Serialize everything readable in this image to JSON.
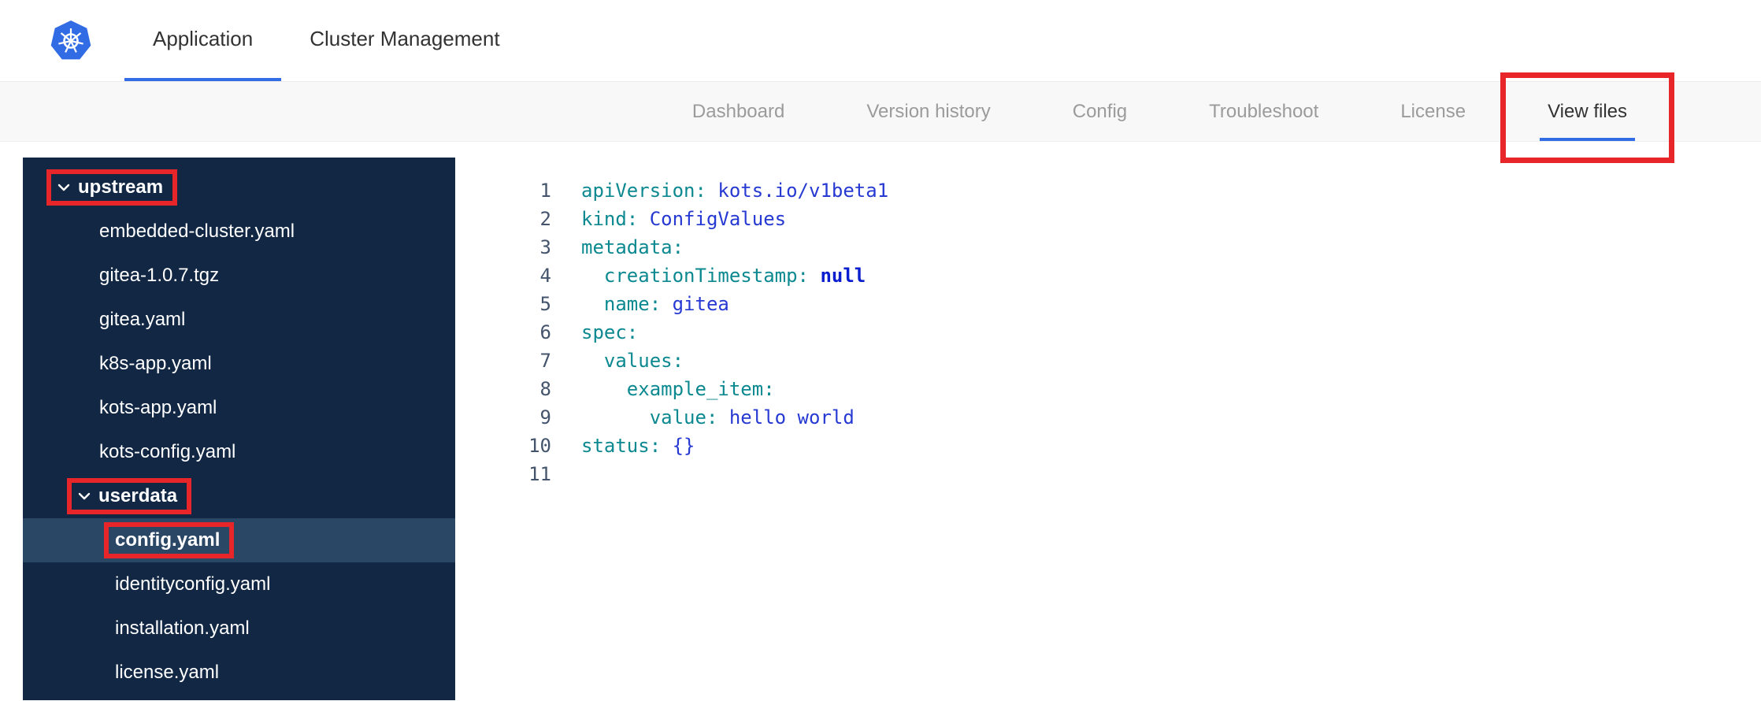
{
  "header": {
    "tabs": [
      {
        "label": "Application",
        "active": true
      },
      {
        "label": "Cluster Management",
        "active": false
      }
    ]
  },
  "subnav": {
    "tabs": [
      {
        "label": "Dashboard",
        "active": false,
        "annotated": false
      },
      {
        "label": "Version history",
        "active": false,
        "annotated": false
      },
      {
        "label": "Config",
        "active": false,
        "annotated": false
      },
      {
        "label": "Troubleshoot",
        "active": false,
        "annotated": false
      },
      {
        "label": "License",
        "active": false,
        "annotated": false
      },
      {
        "label": "View files",
        "active": true,
        "annotated": true
      }
    ]
  },
  "file_tree": {
    "items": [
      {
        "kind": "folder",
        "label": "upstream",
        "level": 0,
        "expanded": true,
        "annotated": true,
        "selected": false
      },
      {
        "kind": "file",
        "label": "embedded-cluster.yaml",
        "level": 1,
        "annotated": false,
        "selected": false
      },
      {
        "kind": "file",
        "label": "gitea-1.0.7.tgz",
        "level": 1,
        "annotated": false,
        "selected": false
      },
      {
        "kind": "file",
        "label": "gitea.yaml",
        "level": 1,
        "annotated": false,
        "selected": false
      },
      {
        "kind": "file",
        "label": "k8s-app.yaml",
        "level": 1,
        "annotated": false,
        "selected": false
      },
      {
        "kind": "file",
        "label": "kots-app.yaml",
        "level": 1,
        "annotated": false,
        "selected": false
      },
      {
        "kind": "file",
        "label": "kots-config.yaml",
        "level": 1,
        "annotated": false,
        "selected": false
      },
      {
        "kind": "folder",
        "label": "userdata",
        "level": 1,
        "expanded": true,
        "annotated": true,
        "selected": false
      },
      {
        "kind": "file",
        "label": "config.yaml",
        "level": 2,
        "annotated": true,
        "selected": true
      },
      {
        "kind": "file",
        "label": "identityconfig.yaml",
        "level": 2,
        "annotated": false,
        "selected": false
      },
      {
        "kind": "file",
        "label": "installation.yaml",
        "level": 2,
        "annotated": false,
        "selected": false
      },
      {
        "kind": "file",
        "label": "license.yaml",
        "level": 2,
        "annotated": false,
        "selected": false
      }
    ]
  },
  "editor": {
    "lines": [
      {
        "num": "1",
        "tokens": [
          [
            "key",
            "apiVersion:"
          ],
          [
            "plain",
            " "
          ],
          [
            "value",
            "kots.io/v1beta1"
          ]
        ]
      },
      {
        "num": "2",
        "tokens": [
          [
            "key",
            "kind:"
          ],
          [
            "plain",
            " "
          ],
          [
            "value",
            "ConfigValues"
          ]
        ]
      },
      {
        "num": "3",
        "tokens": [
          [
            "key",
            "metadata:"
          ]
        ]
      },
      {
        "num": "4",
        "tokens": [
          [
            "plain",
            "  "
          ],
          [
            "key",
            "creationTimestamp:"
          ],
          [
            "plain",
            " "
          ],
          [
            "keyword",
            "null"
          ]
        ]
      },
      {
        "num": "5",
        "tokens": [
          [
            "plain",
            "  "
          ],
          [
            "key",
            "name:"
          ],
          [
            "plain",
            " "
          ],
          [
            "value",
            "gitea"
          ]
        ]
      },
      {
        "num": "6",
        "tokens": [
          [
            "key",
            "spec:"
          ]
        ]
      },
      {
        "num": "7",
        "tokens": [
          [
            "plain",
            "  "
          ],
          [
            "key",
            "values:"
          ]
        ]
      },
      {
        "num": "8",
        "tokens": [
          [
            "plain",
            "    "
          ],
          [
            "key",
            "example_item:"
          ]
        ]
      },
      {
        "num": "9",
        "tokens": [
          [
            "plain",
            "      "
          ],
          [
            "key",
            "value:"
          ],
          [
            "plain",
            " "
          ],
          [
            "value",
            "hello world"
          ]
        ]
      },
      {
        "num": "10",
        "tokens": [
          [
            "key",
            "status:"
          ],
          [
            "plain",
            " "
          ],
          [
            "punct",
            "{}"
          ]
        ]
      },
      {
        "num": "11",
        "tokens": []
      }
    ]
  },
  "colors": {
    "accent_blue": "#326de6",
    "sidebar_bg": "#112744",
    "sidebar_selected": "#2b4766",
    "annotation_red": "#e8262a",
    "code_key": "#0c8990",
    "code_value": "#2639d2",
    "code_keyword": "#0b1ecf",
    "code_gutter": "#44546c"
  }
}
